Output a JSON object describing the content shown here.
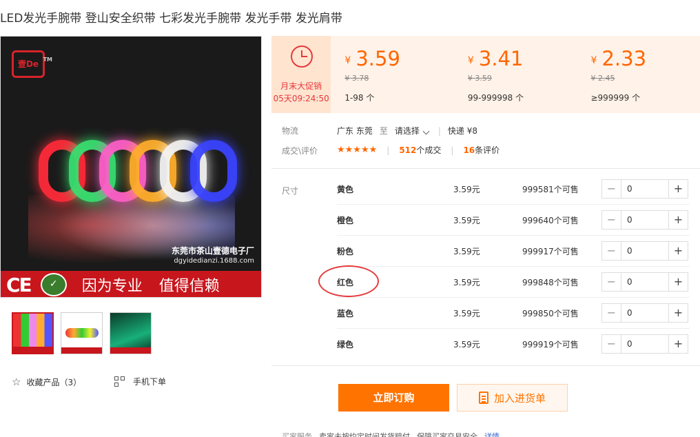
{
  "product": {
    "title": "LED发光手腕带 登山安全织带 七彩发光手腕带 发光手带 发光肩带"
  },
  "image": {
    "logo_text": "壹De",
    "logo_tm": "TM",
    "company": "东莞市茶山壹德电子厂",
    "url": "dgyidedianzi.1688.com",
    "ce_mark": "CE",
    "slogan1": "因为专业",
    "slogan2": "值得信赖",
    "band_colors": [
      "#ff2a3a",
      "#38e070",
      "#ff5fc8",
      "#ffae2a",
      "#f4f4f4",
      "#3a44ff"
    ]
  },
  "gallery": {
    "thumbnails": [
      {
        "name": "thumb-1",
        "active": true
      },
      {
        "name": "thumb-2",
        "active": false
      },
      {
        "name": "thumb-3",
        "active": false
      }
    ]
  },
  "actions_left": {
    "favorite_label": "收藏产品（3）",
    "mobile_label": "手机下单"
  },
  "promo": {
    "label": "月末大促销",
    "timer": "05天09:24:50"
  },
  "price_tiers": [
    {
      "yen": "¥",
      "price": "3.59",
      "old": "¥ 3.78",
      "range": "1-98 个"
    },
    {
      "yen": "¥",
      "price": "3.41",
      "old": "¥ 3.59",
      "range": "99-999998 个"
    },
    {
      "yen": "¥",
      "price": "2.33",
      "old": "¥ 2.45",
      "range": "≥999999 个"
    }
  ],
  "logistics": {
    "label": "物流",
    "from": "广东 东莞",
    "to_word": "至",
    "select": "请选择",
    "express": "快递 ¥8"
  },
  "reviews": {
    "label": "成交\\评价",
    "stars": "★★★★★",
    "deals_count": "512",
    "deals_suffix": "个成交",
    "review_count": "16",
    "review_suffix": "条评价"
  },
  "sku": {
    "label": "尺寸",
    "rows": [
      {
        "name": "黄色",
        "price": "3.59元",
        "stock": "999581个可售",
        "qty": "0"
      },
      {
        "name": "橙色",
        "price": "3.59元",
        "stock": "999640个可售",
        "qty": "0"
      },
      {
        "name": "粉色",
        "price": "3.59元",
        "stock": "999917个可售",
        "qty": "0"
      },
      {
        "name": "红色",
        "price": "3.59元",
        "stock": "999848个可售",
        "qty": "0"
      },
      {
        "name": "蓝色",
        "price": "3.59元",
        "stock": "999850个可售",
        "qty": "0"
      },
      {
        "name": "绿色",
        "price": "3.59元",
        "stock": "999919个可售",
        "qty": "0"
      }
    ],
    "minus": "−",
    "plus": "+"
  },
  "buttons": {
    "order": "立即订购",
    "cart": "加入进货单"
  },
  "service": {
    "label": "买家服务",
    "text": "卖家未按约定时间发货赔付",
    "text2": "保障买家交易安全",
    "link": "详情"
  },
  "colors": {
    "accent": "#ff7300",
    "brand_red": "#c8161d",
    "promo_red": "#e4393c"
  }
}
